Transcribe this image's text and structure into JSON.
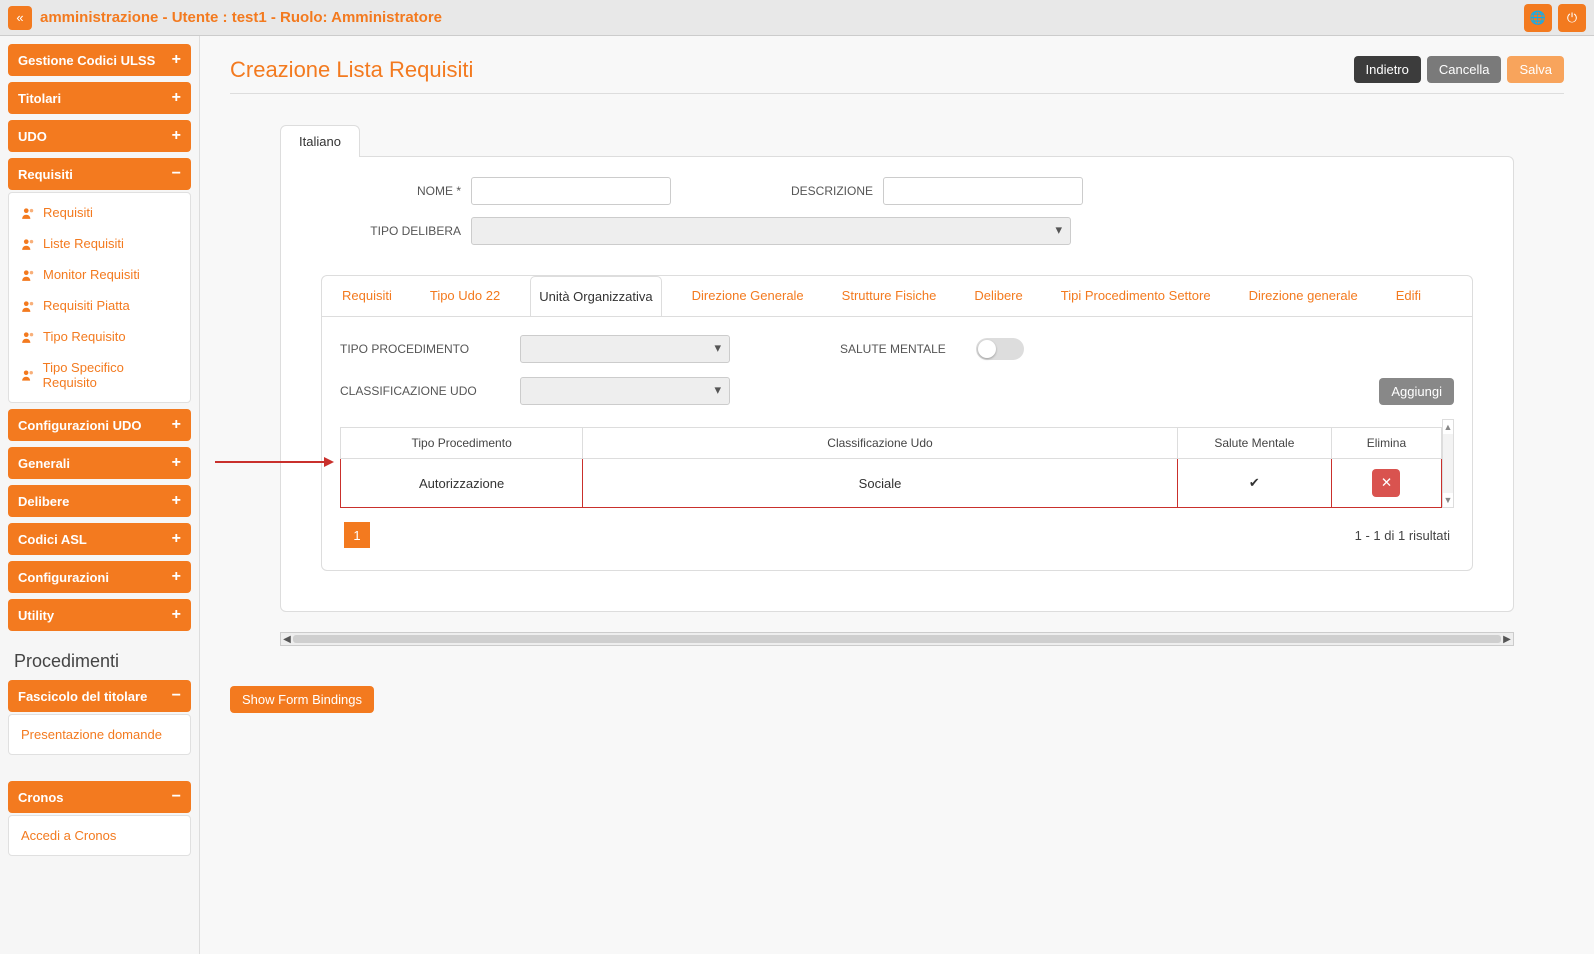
{
  "topbar": {
    "title": "amministrazione - Utente : test1 - Ruolo: Amministratore"
  },
  "sidebar": {
    "panels": [
      {
        "label": "Gestione Codici ULSS",
        "toggle": "+"
      },
      {
        "label": "Titolari",
        "toggle": "+"
      },
      {
        "label": "UDO",
        "toggle": "+"
      },
      {
        "label": "Requisiti",
        "toggle": "−",
        "items": [
          {
            "label": "Requisiti"
          },
          {
            "label": "Liste Requisiti"
          },
          {
            "label": "Monitor Requisiti"
          },
          {
            "label": "Requisiti Piatta"
          },
          {
            "label": "Tipo Requisito"
          },
          {
            "label": "Tipo Specifico Requisito"
          }
        ]
      },
      {
        "label": "Configurazioni UDO",
        "toggle": "+"
      },
      {
        "label": "Generali",
        "toggle": "+"
      },
      {
        "label": "Delibere",
        "toggle": "+"
      },
      {
        "label": "Codici ASL",
        "toggle": "+"
      },
      {
        "label": "Configurazioni",
        "toggle": "+"
      },
      {
        "label": "Utility",
        "toggle": "+"
      }
    ],
    "section_title": "Procedimenti",
    "fascicolo": {
      "label": "Fascicolo del titolare",
      "toggle": "−",
      "item": "Presentazione domande"
    },
    "cronos": {
      "label": "Cronos",
      "toggle": "−",
      "item": "Accedi a Cronos"
    }
  },
  "page": {
    "title": "Creazione Lista Requisiti",
    "buttons": {
      "back": "Indietro",
      "cancel": "Cancella",
      "save": "Salva"
    },
    "lang_tab": "Italiano",
    "form": {
      "nome_label": "NOME *",
      "descrizione_label": "DESCRIZIONE",
      "tipo_delibera_label": "TIPO DELIBERA"
    },
    "tabs": [
      "Requisiti",
      "Tipo Udo 22",
      "Unità Organizzativa",
      "Direzione Generale",
      "Strutture Fisiche",
      "Delibere",
      "Tipi Procedimento Settore",
      "Direzione generale",
      "Edifi"
    ],
    "active_tab_index": 2,
    "inner": {
      "tipo_procedimento_label": "TIPO PROCEDIMENTO",
      "salute_mentale_label": "SALUTE MENTALE",
      "classificazione_udo_label": "CLASSIFICAZIONE UDO",
      "aggiungi": "Aggiungi",
      "table": {
        "headers": [
          "Tipo Procedimento",
          "Classificazione Udo",
          "Salute Mentale",
          "Elimina"
        ],
        "rows": [
          {
            "tipo": "Autorizzazione",
            "classificazione": "Sociale",
            "salute": "✔"
          }
        ]
      },
      "pager": "1",
      "results": "1 - 1 di 1 risultati"
    },
    "show_form_bindings": "Show Form Bindings"
  }
}
